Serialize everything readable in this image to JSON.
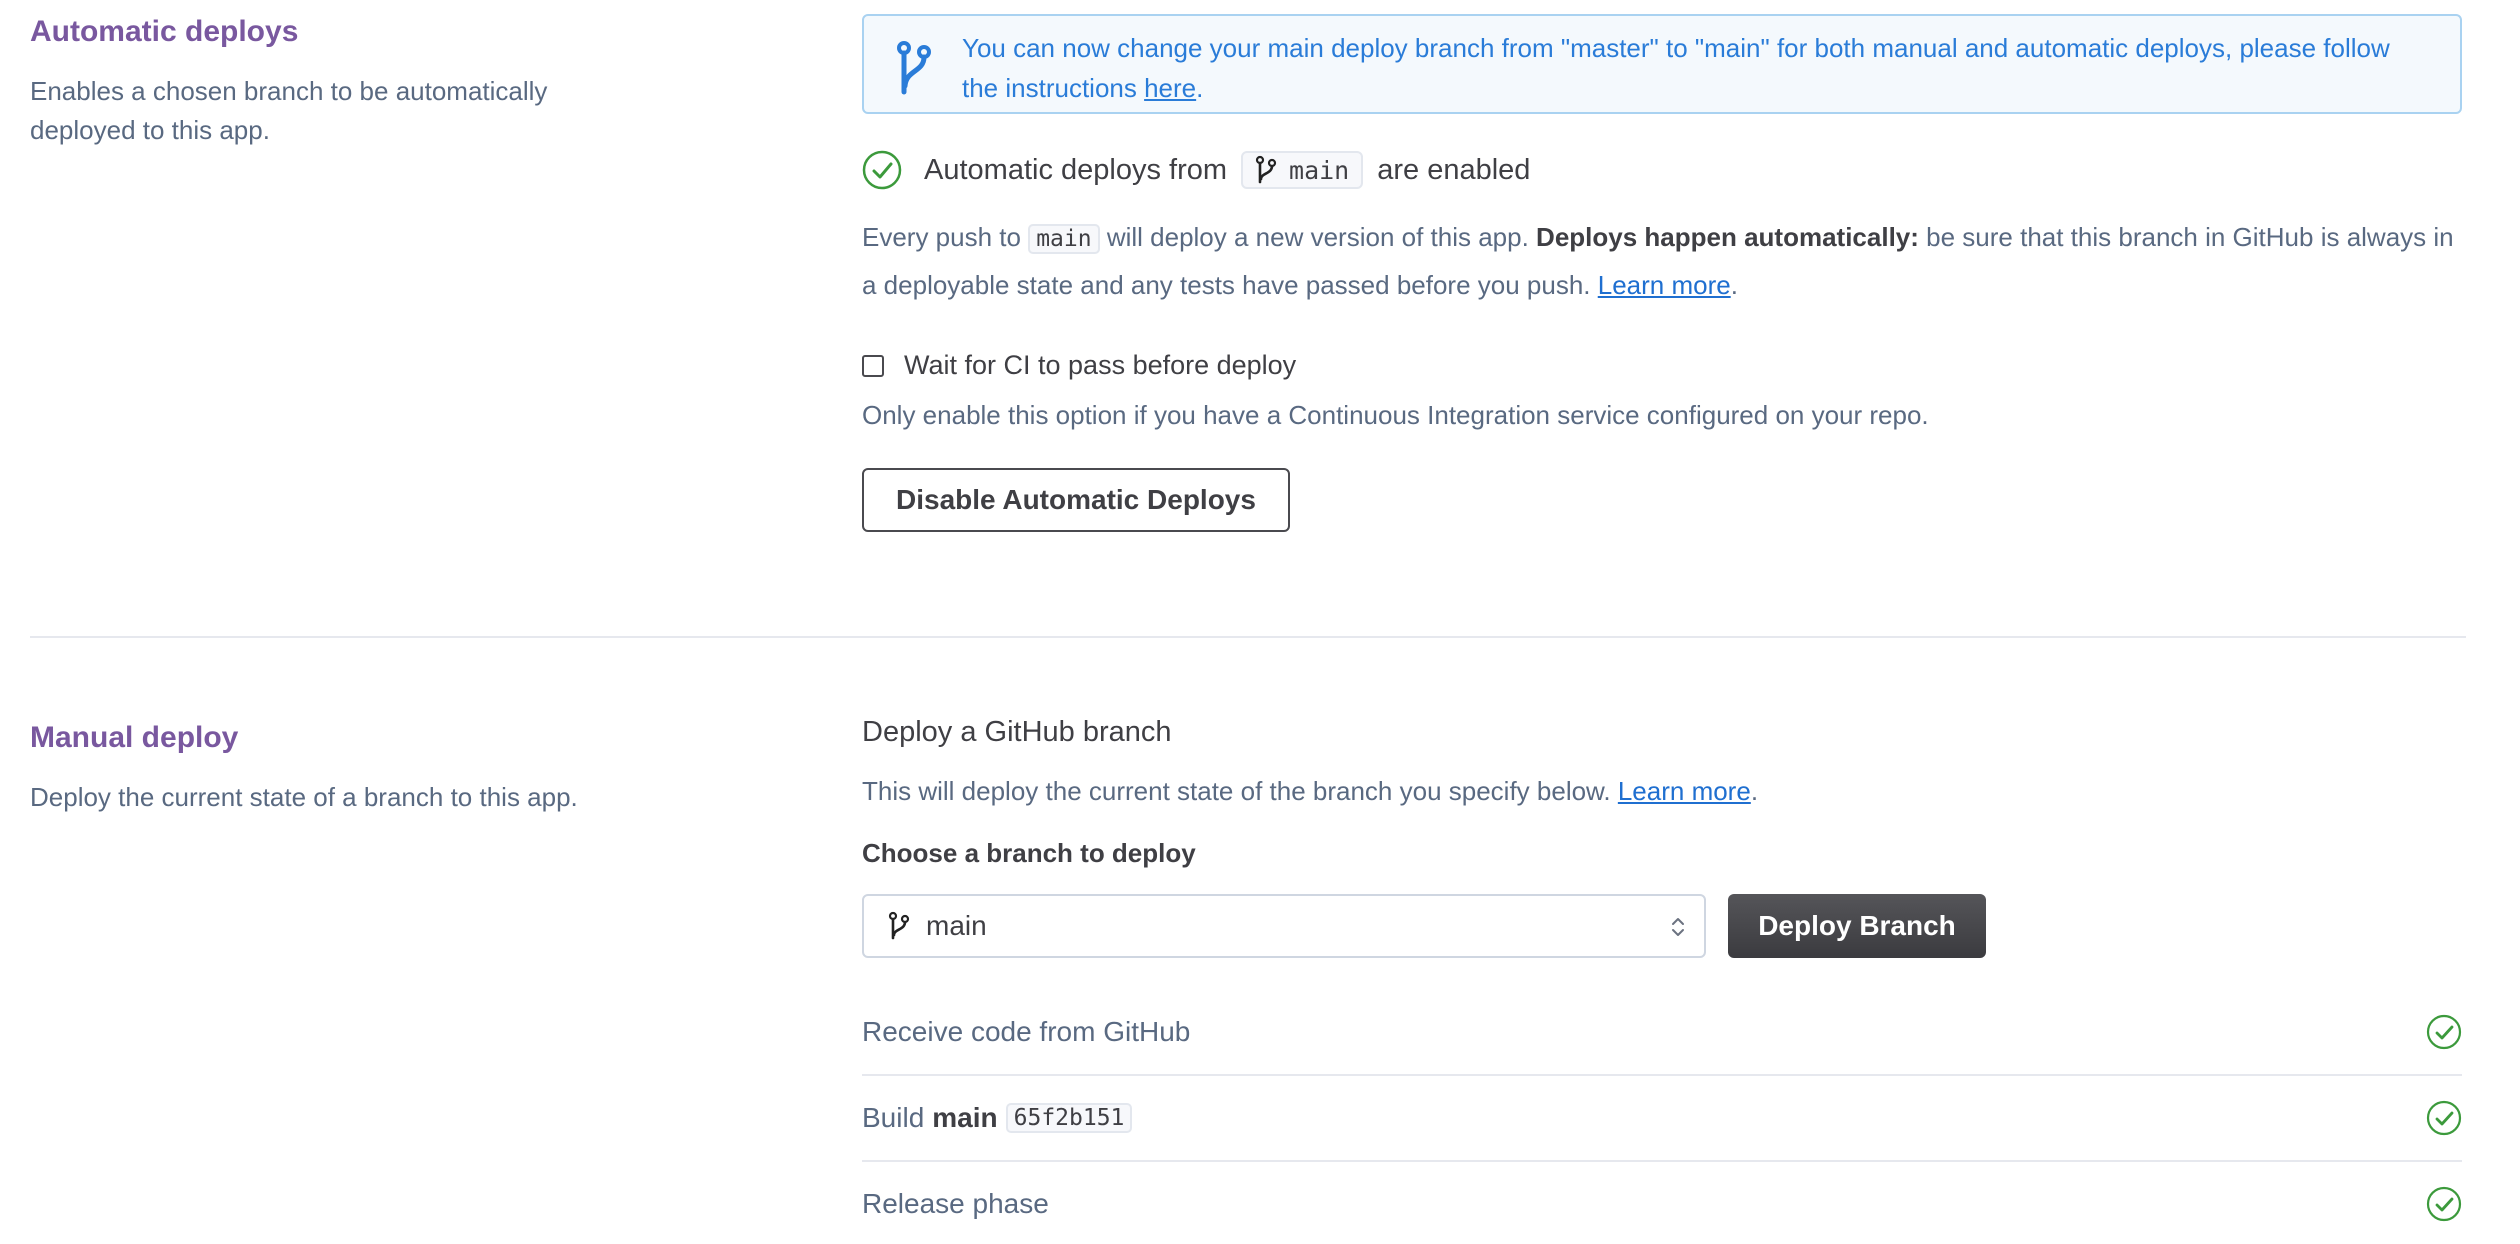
{
  "auto_deploys": {
    "title": "Automatic deploys",
    "description": "Enables a chosen branch to be automatically deployed to this app.",
    "notice": {
      "text": "You can now change your main deploy branch from \"master\" to \"main\" for both manual and automatic deploys, please follow the instructions ",
      "link_label": "here",
      "end": "."
    },
    "status": {
      "prefix": "Automatic deploys from",
      "branch": "main",
      "suffix": "are enabled"
    },
    "push_info": {
      "part1": "Every push to ",
      "branch": "main",
      "part2": " will deploy a new version of this app. ",
      "bold": "Deploys happen automatically:",
      "part3": " be sure that this branch in GitHub is always in a deployable state and any tests have passed before you push. ",
      "link_label": "Learn more",
      "end": "."
    },
    "ci_checkbox": {
      "label": "Wait for CI to pass before deploy",
      "checked": false,
      "help": "Only enable this option if you have a Continuous Integration service configured on your repo."
    },
    "disable_button_label": "Disable Automatic Deploys"
  },
  "manual_deploy": {
    "title": "Manual deploy",
    "description": "Deploy the current state of a branch to this app.",
    "heading": "Deploy a GitHub branch",
    "info": "This will deploy the current state of the branch you specify below. ",
    "info_link": "Learn more",
    "info_end": ".",
    "choose_label": "Choose a branch to deploy",
    "selected_branch": "main",
    "deploy_button_label": "Deploy Branch",
    "steps": [
      {
        "label": "Receive code from GitHub",
        "status": "done"
      },
      {
        "label": "Build",
        "branch": "main",
        "commit": "65f2b151",
        "status": "done"
      },
      {
        "label": "Release phase",
        "status": "done"
      }
    ]
  },
  "colors": {
    "section_title": "#79589f",
    "info_blue": "#2a7cd8",
    "success_green": "#3c9a3c",
    "dark_button": "#3b3b3f"
  },
  "icons": {
    "notice": "git-branch-icon",
    "status": "check-circle-icon",
    "branch": "git-branch-icon",
    "select": "chevron-up-down-icon"
  }
}
